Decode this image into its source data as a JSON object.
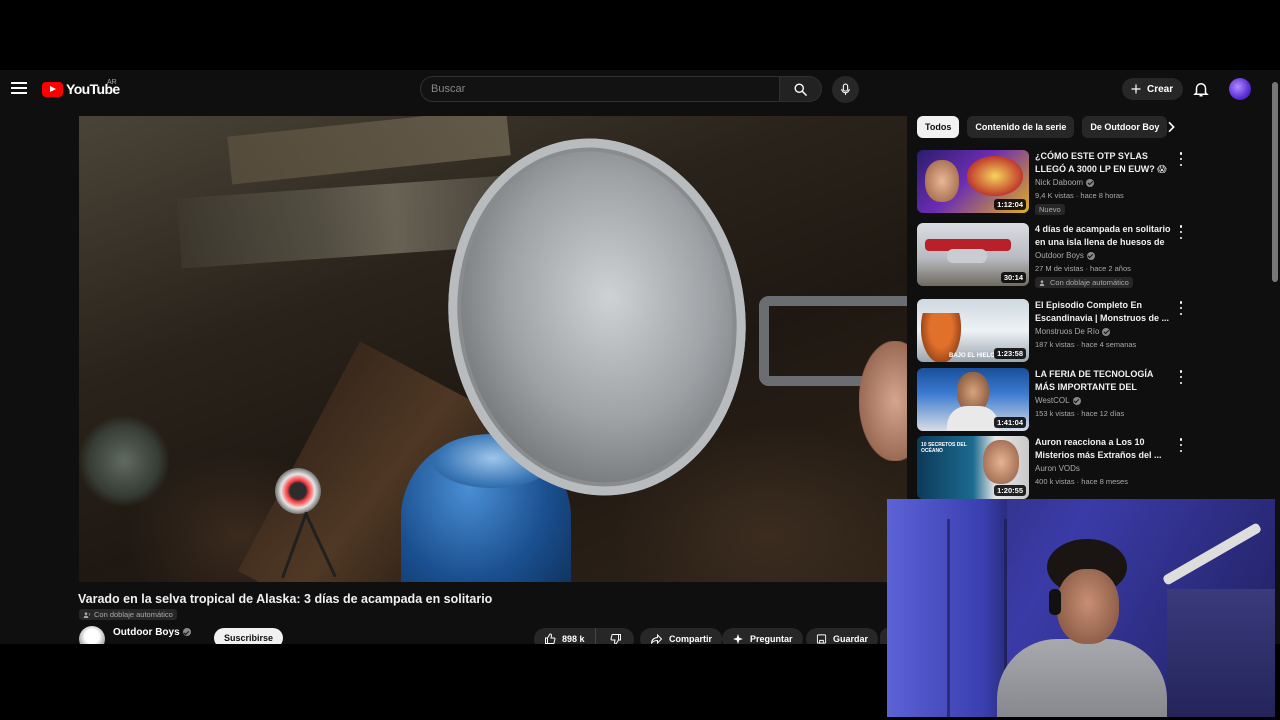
{
  "header": {
    "logo_text": "YouTube",
    "country_code": "AR",
    "search_placeholder": "Buscar",
    "create_label": "Crear"
  },
  "video": {
    "title": "Varado en la selva tropical de Alaska: 3 días de acampada en solitario",
    "dub_label": "Con doblaje automático",
    "channel": "Outdoor Boys",
    "subscribe_label": "Suscribirse",
    "likes": "898 k",
    "share_label": "Compartir",
    "ask_label": "Preguntar",
    "save_label": "Guardar"
  },
  "chips": [
    "Todos",
    "Contenido de la serie",
    "De Outdoor Boy"
  ],
  "recommendations": [
    {
      "title": "¿CÓMO ESTE OTP SYLAS LLEGÓ A 3000 LP EN EUW? 😱",
      "channel": "Nick Daboom",
      "meta": "9,4 K vistas · hace 8 horas",
      "duration": "1:12:04",
      "badge": "Nuevo",
      "thumb_colors": [
        "#2b1d6e",
        "#e0b020"
      ]
    },
    {
      "title": "4 días de acampada en solitario en una isla llena de huesos de ...",
      "channel": "Outdoor Boys",
      "meta": "27 M de vistas · hace 2 años",
      "duration": "30:14",
      "badge": "Con doblaje automático",
      "thumb_colors": [
        "#c9ccd0",
        "#b8202a"
      ]
    },
    {
      "title": "El Episodio Completo En Escandinavia | Monstruos de ...",
      "channel": "Monstruos De Río",
      "meta": "187 k vistas · hace 4 semanas",
      "duration": "1:23:58",
      "thumb_text": "BAJO EL HIELO",
      "thumb_colors": [
        "#dfe6ec",
        "#e0702a"
      ]
    },
    {
      "title": "LA FERIA DE TECNOLOGÍA MÁS IMPORTANTE DEL MUNDO ...",
      "channel": "WestCOL",
      "meta": "153 k vistas · hace 12 días",
      "duration": "1:41:04",
      "thumb_colors": [
        "#1a4f9c",
        "#d8dee6"
      ]
    },
    {
      "title": "Auron reacciona a Los 10 Misterios más Extraños del ...",
      "channel": "Auron VODs",
      "meta": "400 k vistas · hace 8 meses",
      "duration": "1:20:55",
      "thumb_text": "10 SECRETOS DEL OCÉANO",
      "thumb_colors": [
        "#0d3a5a",
        "#ffffff"
      ]
    }
  ]
}
